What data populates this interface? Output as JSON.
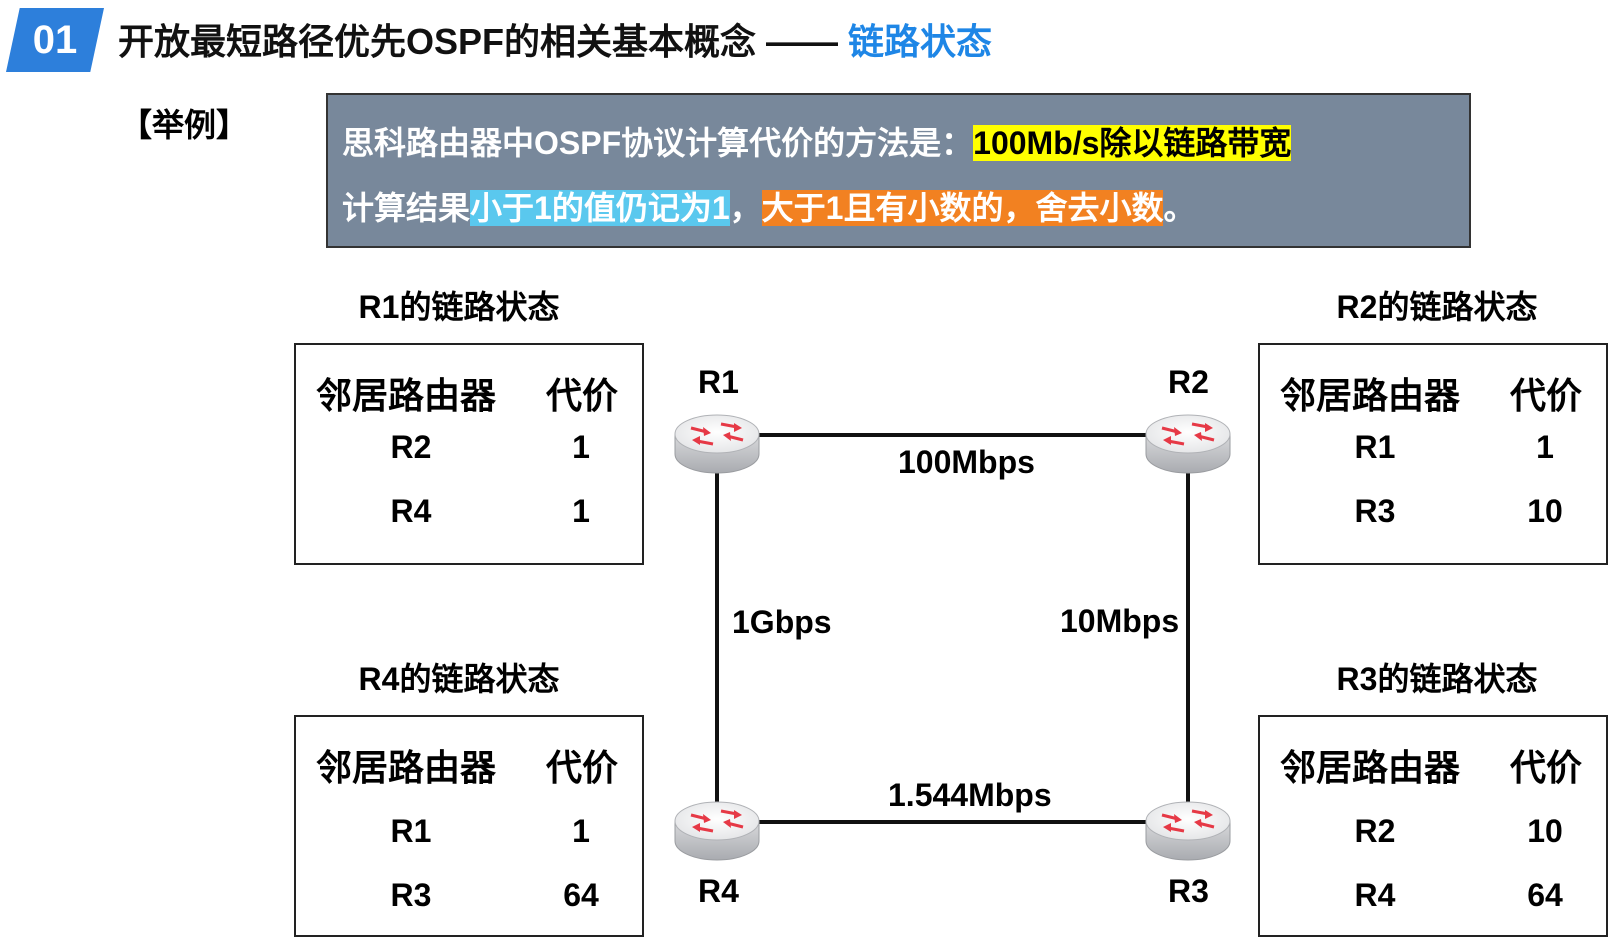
{
  "header": {
    "badge": "01",
    "title_main": "开放最短路径优先OSPF的相关基本概念 —— ",
    "title_highlight": "链路状态"
  },
  "example_label": "【举例】",
  "note": {
    "line1_prefix": "思科路由器中OSPF协议计算代价的方法是：",
    "line1_highlight": "100Mb/s除以链路带宽",
    "line2_prefix": "计算结果",
    "line2_cyan": "小于1的值仍记为1",
    "line2_sep": "，",
    "line2_orange": "大于1且有小数的，舍去小数",
    "line2_end": "。"
  },
  "tables": {
    "r1": {
      "title": "R1的链路状态",
      "col_neighbor": "邻居路由器",
      "col_cost": "代价",
      "rows": [
        {
          "neighbor": "R2",
          "cost": "1"
        },
        {
          "neighbor": "R4",
          "cost": "1"
        }
      ]
    },
    "r2": {
      "title": "R2的链路状态",
      "col_neighbor": "邻居路由器",
      "col_cost": "代价",
      "rows": [
        {
          "neighbor": "R1",
          "cost": "1"
        },
        {
          "neighbor": "R3",
          "cost": "10"
        }
      ]
    },
    "r4": {
      "title": "R4的链路状态",
      "col_neighbor": "邻居路由器",
      "col_cost": "代价",
      "rows": [
        {
          "neighbor": "R1",
          "cost": "1"
        },
        {
          "neighbor": "R3",
          "cost": "64"
        }
      ]
    },
    "r3": {
      "title": "R3的链路状态",
      "col_neighbor": "邻居路由器",
      "col_cost": "代价",
      "rows": [
        {
          "neighbor": "R2",
          "cost": "10"
        },
        {
          "neighbor": "R4",
          "cost": "64"
        }
      ]
    }
  },
  "network": {
    "routers": {
      "r1": "R1",
      "r2": "R2",
      "r3": "R3",
      "r4": "R4"
    },
    "links": {
      "r1_r2": "100Mbps",
      "r1_r4": "1Gbps",
      "r2_r3": "10Mbps",
      "r4_r3": "1.544Mbps"
    },
    "router_icon": "router-icon"
  },
  "colors": {
    "badge": "#2d7fdb",
    "title_highlight": "#1e86e6",
    "note_bg": "#78889b",
    "highlight_yellow": "#ffff00",
    "highlight_cyan": "#5ac8ee",
    "highlight_orange": "#f28121"
  }
}
